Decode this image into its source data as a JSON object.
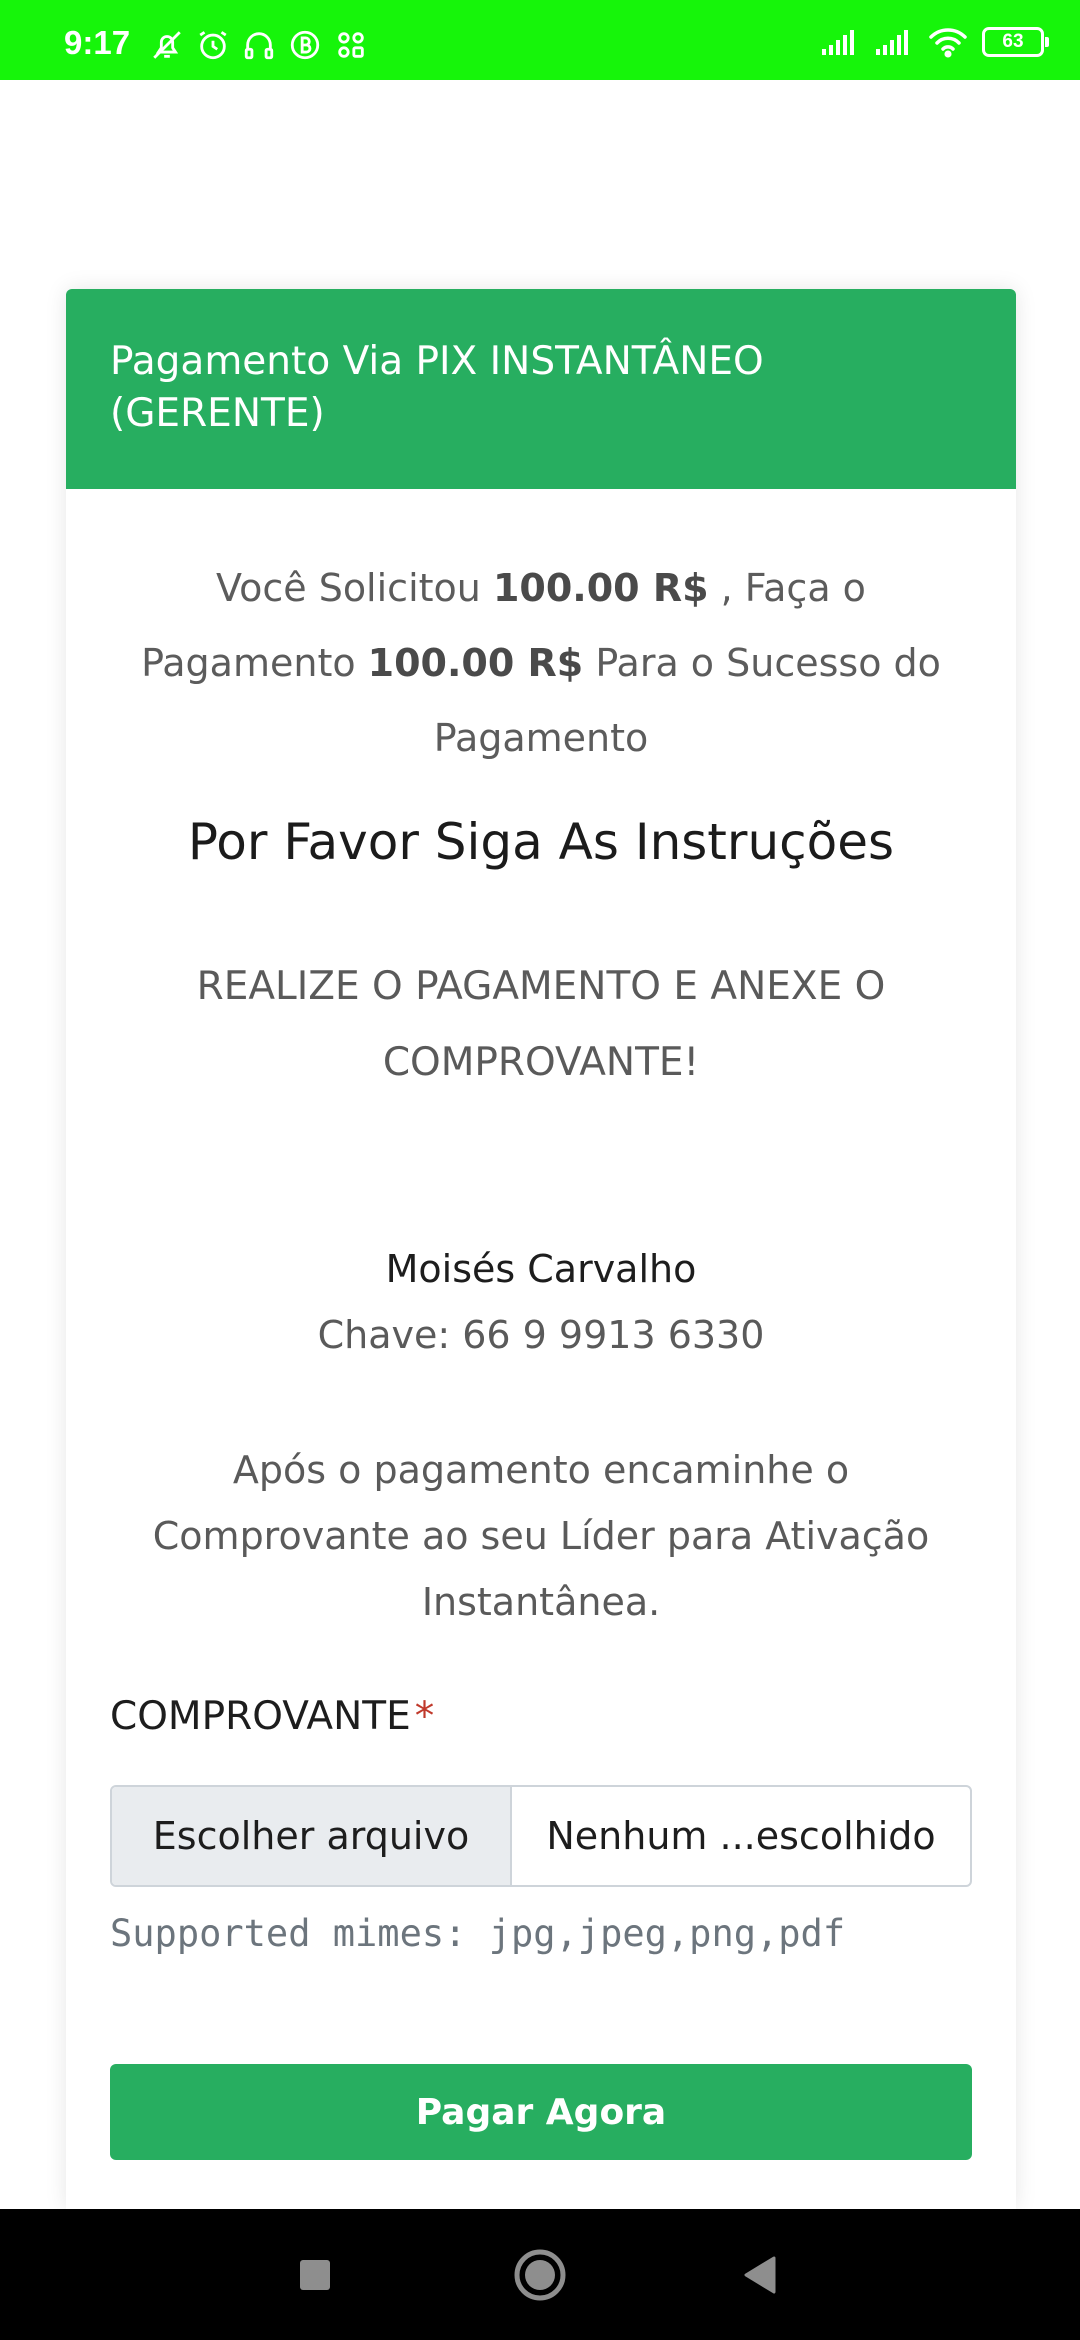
{
  "status_bar": {
    "time": "9:17",
    "battery": "63",
    "background_color": "#16f50a",
    "left_icons": [
      "notification-muted-icon",
      "alarm-icon",
      "headphones-icon",
      "b-app-icon",
      "apps-icon"
    ],
    "right_icons": [
      "signal-icon",
      "signal-icon",
      "wifi-icon",
      "battery-icon"
    ]
  },
  "card": {
    "header_title": "Pagamento Via PIX INSTANTÂNEO (GERENTE)",
    "header_color": "#27ae60",
    "intro": {
      "part1": "Você Solicitou ",
      "amount1": "100.00 R$",
      "part2": " , Faça o Pagamento ",
      "amount2": "100.00 R$",
      "part3": " Para o Sucesso do Pagamento"
    },
    "instructions_title": "Por Favor Siga As Instruções",
    "realize_text": "REALIZE O PAGAMENTO E ANEXE O COMPROVANTE!",
    "recipient_name": "Moisés Carvalho",
    "pix_key": "Chave: 66 9 9913 6330",
    "after_payment_text": "Após o pagamento encaminhe o Comprovante ao seu Líder para Ativação Instantânea.",
    "receipt_label": "COMPROVANTE",
    "required_marker": "*",
    "file_choose_label": "Escolher arquivo",
    "file_name_label": "Nenhum ...escolhido",
    "supported_mimes": "Supported mimes: jpg,jpeg,png,pdf",
    "pay_button_label": "Pagar Agora"
  },
  "nav_bar": {
    "buttons": [
      "recents-square-icon",
      "home-circle-icon",
      "back-triangle-icon"
    ]
  }
}
